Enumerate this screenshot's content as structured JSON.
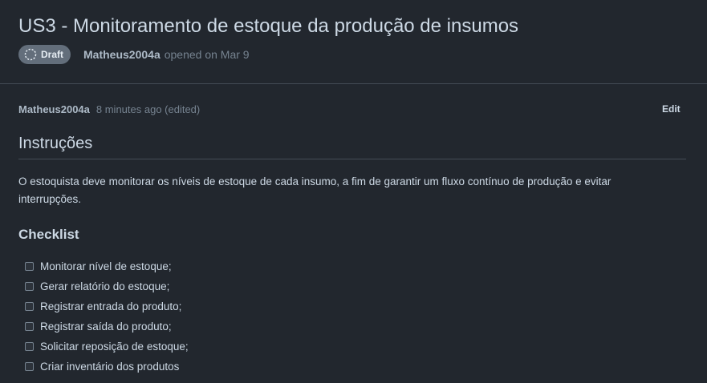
{
  "issue": {
    "title": "US3 - Monitoramento de estoque da produção de insumos",
    "status": "Draft",
    "author": "Matheus2004a",
    "opened_text": "opened on Mar 9"
  },
  "comment": {
    "author": "Matheus2004a",
    "time": "8 minutes ago (edited)",
    "edit_label": "Edit",
    "heading": "Instruções",
    "paragraph": "O estoquista deve monitorar os níveis de estoque de cada insumo, a fim de garantir um fluxo contínuo de produção e evitar interrupções.",
    "checklist_title": "Checklist",
    "checklist": [
      {
        "label": "Monitorar nível de estoque;",
        "checked": false
      },
      {
        "label": "Gerar relatório do estoque;",
        "checked": false
      },
      {
        "label": "Registrar entrada do produto;",
        "checked": false
      },
      {
        "label": "Registrar saída do produto;",
        "checked": false
      },
      {
        "label": "Solicitar reposição de estoque;",
        "checked": false
      },
      {
        "label": "Criar inventário dos produtos",
        "checked": false
      }
    ]
  },
  "icons": {
    "status": "draft-circle-icon"
  },
  "colors": {
    "background": "#22272e",
    "badge": "#636e7b",
    "border": "#444c56",
    "muted": "#768390"
  }
}
